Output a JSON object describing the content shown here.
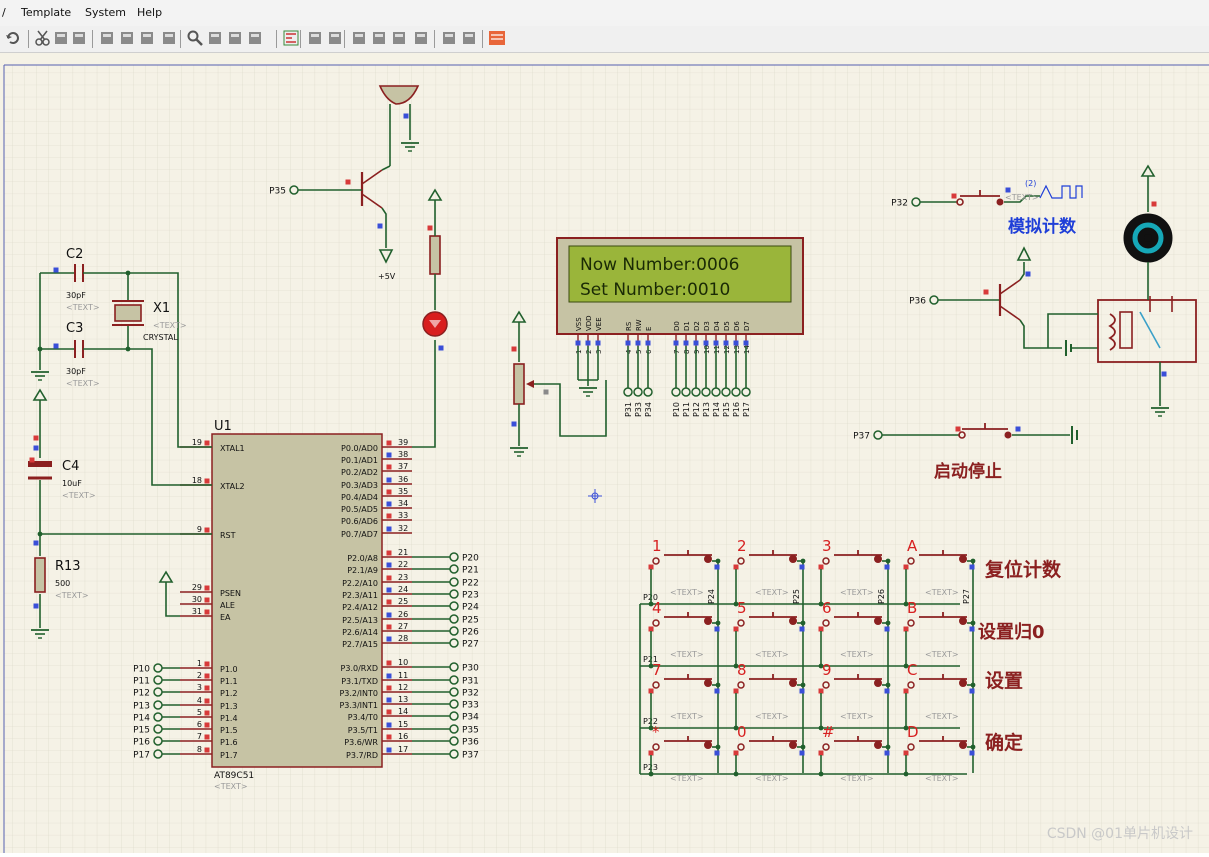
{
  "menu": [
    "/",
    "Template",
    "System",
    "Help"
  ],
  "toolbar_icons": [
    "undo-icon",
    "cut-icon",
    "copy-icon",
    "paste-icon",
    "block-copy-icon",
    "block-move-icon",
    "block-rotate-icon",
    "block-delete-icon",
    "zoom-icon",
    "wire-autorouter-icon",
    "search-tag-icon",
    "property-assign-icon",
    "design-explorer-icon",
    "search-icon",
    "property-tool-icon",
    "new-sheet-icon",
    "remove-sheet-icon",
    "netlist-icon",
    "bill-of-materials-icon",
    "electrical-rule-check-icon",
    "export-icon",
    "pcb-layout-icon"
  ],
  "colors": {
    "sheet": "#f4f1e4",
    "grid": "#d8d5c6",
    "wire": "#21602d",
    "component": "#8b2020",
    "body": "#c6c3a4",
    "lcd_bg": "#9ab53a",
    "lcd_text": "#1a2a05",
    "red_label": "#d72121",
    "blue_label": "#1f3fd8"
  },
  "mcu": {
    "ref": "U1",
    "part": "AT89C51",
    "text": "<TEXT>",
    "left_pins": [
      {
        "num": "19",
        "name": "XTAL1"
      },
      {
        "num": "18",
        "name": "XTAL2"
      },
      {
        "num": "9",
        "name": "RST"
      },
      {
        "num": "29",
        "name": "PSEN"
      },
      {
        "num": "30",
        "name": "ALE"
      },
      {
        "num": "31",
        "name": "EA"
      },
      {
        "num": "1",
        "name": "P1.0"
      },
      {
        "num": "2",
        "name": "P1.1"
      },
      {
        "num": "3",
        "name": "P1.2"
      },
      {
        "num": "4",
        "name": "P1.3"
      },
      {
        "num": "5",
        "name": "P1.4"
      },
      {
        "num": "6",
        "name": "P1.5"
      },
      {
        "num": "7",
        "name": "P1.6"
      },
      {
        "num": "8",
        "name": "P1.7"
      }
    ],
    "right_pins": [
      {
        "num": "39",
        "name": "P0.0/AD0"
      },
      {
        "num": "38",
        "name": "P0.1/AD1"
      },
      {
        "num": "37",
        "name": "P0.2/AD2"
      },
      {
        "num": "36",
        "name": "P0.3/AD3"
      },
      {
        "num": "35",
        "name": "P0.4/AD4"
      },
      {
        "num": "34",
        "name": "P0.5/AD5"
      },
      {
        "num": "33",
        "name": "P0.6/AD6"
      },
      {
        "num": "32",
        "name": "P0.7/AD7"
      },
      {
        "num": "21",
        "name": "P2.0/A8"
      },
      {
        "num": "22",
        "name": "P2.1/A9"
      },
      {
        "num": "23",
        "name": "P2.2/A10"
      },
      {
        "num": "24",
        "name": "P2.3/A11"
      },
      {
        "num": "25",
        "name": "P2.4/A12"
      },
      {
        "num": "26",
        "name": "P2.5/A13"
      },
      {
        "num": "27",
        "name": "P2.6/A14"
      },
      {
        "num": "28",
        "name": "P2.7/A15"
      },
      {
        "num": "10",
        "name": "P3.0/RXD"
      },
      {
        "num": "11",
        "name": "P3.1/TXD"
      },
      {
        "num": "12",
        "name": "P3.2/INT0"
      },
      {
        "num": "13",
        "name": "P3.3/INT1"
      },
      {
        "num": "14",
        "name": "P3.4/T0"
      },
      {
        "num": "15",
        "name": "P3.5/T1"
      },
      {
        "num": "16",
        "name": "P3.6/WR"
      },
      {
        "num": "17",
        "name": "P3.7/RD"
      }
    ],
    "p1_terminals": [
      "P10",
      "P11",
      "P12",
      "P13",
      "P14",
      "P15",
      "P16",
      "P17"
    ],
    "p2_terminals": [
      "P20",
      "P21",
      "P22",
      "P23",
      "P24",
      "P25",
      "P26",
      "P27"
    ],
    "p3_terminals": [
      "P30",
      "P31",
      "P32",
      "P33",
      "P34",
      "P35",
      "P36",
      "P37"
    ]
  },
  "components": {
    "c2": {
      "ref": "C2",
      "value": "30pF",
      "text": "<TEXT>"
    },
    "c3": {
      "ref": "C3",
      "value": "30pF",
      "text": "<TEXT>"
    },
    "x1": {
      "ref": "X1",
      "value": "CRYSTAL",
      "text": "<TEXT>"
    },
    "c4": {
      "ref": "C4",
      "value": "10uF",
      "text": "<TEXT>"
    },
    "r13": {
      "ref": "R13",
      "value": "500",
      "text": "<TEXT>"
    },
    "transistor_in": "P35",
    "power_label": "+5V",
    "relay_in": "P36",
    "pulse_in": "P32",
    "pulse_tag": "(2)",
    "pulse_text": "<TEXT>",
    "start_in": "P37"
  },
  "lcd": {
    "line1": "Now Number:0006",
    "line2": "Set Number:0010",
    "pins": [
      {
        "name": "VSS",
        "num": "1"
      },
      {
        "name": "VDD",
        "num": "2"
      },
      {
        "name": "VEE",
        "num": "3"
      },
      {
        "name": "RS",
        "num": "4"
      },
      {
        "name": "RW",
        "num": "5"
      },
      {
        "name": "E",
        "num": "6"
      },
      {
        "name": "D0",
        "num": "7"
      },
      {
        "name": "D1",
        "num": "8"
      },
      {
        "name": "D2",
        "num": "9"
      },
      {
        "name": "D3",
        "num": "10"
      },
      {
        "name": "D4",
        "num": "11"
      },
      {
        "name": "D5",
        "num": "12"
      },
      {
        "name": "D6",
        "num": "13"
      },
      {
        "name": "D7",
        "num": "14"
      }
    ],
    "ctrl_terminals": [
      "P31",
      "P33",
      "P34"
    ],
    "data_terminals": [
      "P10",
      "P11",
      "P12",
      "P13",
      "P14",
      "P15",
      "P16",
      "P17"
    ]
  },
  "labels": {
    "simulate_count": "模拟计数",
    "start_stop": "启动停止",
    "reset_count": "复位计数",
    "set_zero": "设置归0",
    "setting": "设置",
    "confirm": "确定"
  },
  "keypad": {
    "keys": [
      [
        "1",
        "2",
        "3",
        "A"
      ],
      [
        "4",
        "5",
        "6",
        "B"
      ],
      [
        "7",
        "8",
        "9",
        "C"
      ],
      [
        "*",
        "0",
        "#",
        "D"
      ]
    ],
    "key_text": "<TEXT>",
    "row_terminals": [
      "P20",
      "P21",
      "P22",
      "P23"
    ],
    "col_terminals": [
      "P24",
      "P25",
      "P26",
      "P27"
    ]
  },
  "watermark": "CSDN @01单片机设计"
}
